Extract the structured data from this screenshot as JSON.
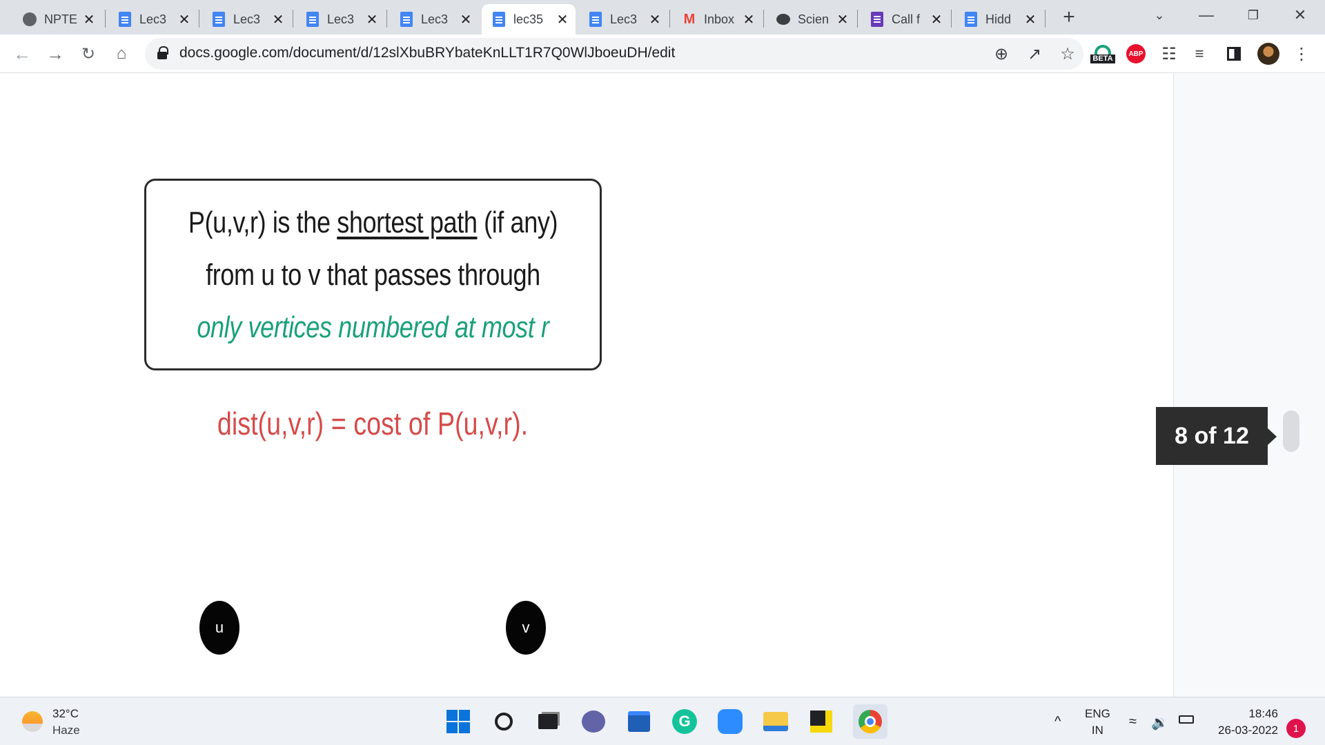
{
  "tabs": [
    {
      "title": "NPTE",
      "icon": "globe-icon",
      "active": false
    },
    {
      "title": "Lec3",
      "icon": "google-docs-icon",
      "active": false
    },
    {
      "title": "Lec3",
      "icon": "google-docs-icon",
      "active": false
    },
    {
      "title": "Lec3",
      "icon": "google-docs-icon",
      "active": false
    },
    {
      "title": "Lec3",
      "icon": "google-docs-icon",
      "active": false
    },
    {
      "title": "lec35",
      "icon": "google-docs-icon",
      "active": true
    },
    {
      "title": "Lec3",
      "icon": "google-docs-icon",
      "active": false
    },
    {
      "title": "Inbox",
      "icon": "gmail-icon",
      "active": false
    },
    {
      "title": "Scien",
      "icon": "chat-icon",
      "active": false
    },
    {
      "title": "Call f",
      "icon": "google-forms-icon",
      "active": false
    },
    {
      "title": "Hidd",
      "icon": "google-docs-icon",
      "active": false
    }
  ],
  "toolbar": {
    "url": "docs.google.com/document/d/12slXbuBRYbateKnLLT1R7Q0WlJboeuDH/edit",
    "beta_label": "BETA",
    "abp_label": "ABP"
  },
  "slide": {
    "line1_before": "P(u,v,r) is the ",
    "line1_underlined": "shortest path",
    "line1_after": " (if any)",
    "line2": "from u to v that passes through",
    "line3": "only vertices numbered at most r",
    "dist": "dist(u,v,r) = cost of P(u,v,r).",
    "node_u": "u",
    "node_v": "v"
  },
  "page_counter": "8 of 12",
  "taskbar": {
    "temperature": "32°C",
    "weather": "Haze",
    "lang_top": "ENG",
    "lang_bottom": "IN",
    "time": "18:46",
    "date": "26-03-2022",
    "notifications": "1"
  },
  "colors": {
    "accent_green": "#1aa07a",
    "accent_red": "#d54b4b",
    "docs_blue": "#4285f4"
  }
}
